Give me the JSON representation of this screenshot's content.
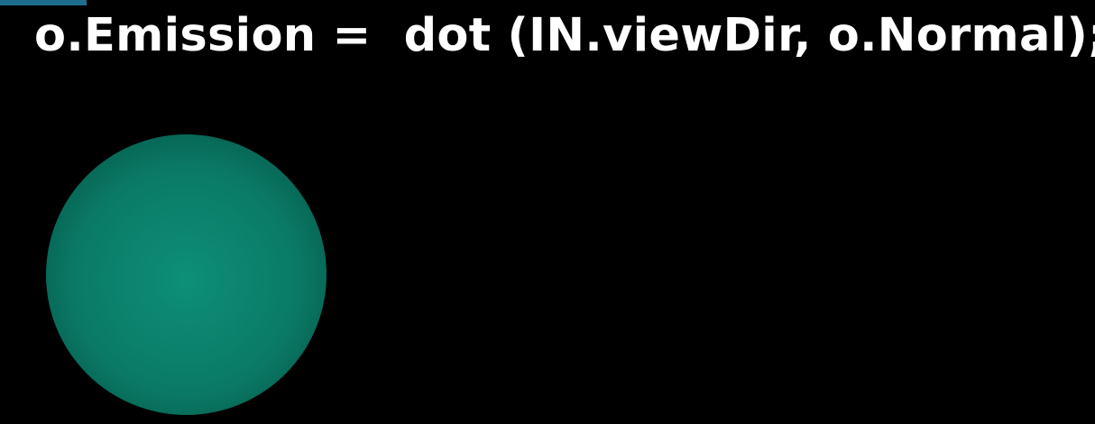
{
  "slide": {
    "code_line": "o.Emission =  dot (IN.viewDir, o.Normal);"
  },
  "sphere": {
    "shape": "sphere",
    "highlight_color": "#0d8f78",
    "mid_color": "#0a7a66",
    "edge_color": "#06594b"
  },
  "colors": {
    "background": "#000000",
    "text": "#ffffff",
    "corner_accent": "#1d6f8d"
  }
}
